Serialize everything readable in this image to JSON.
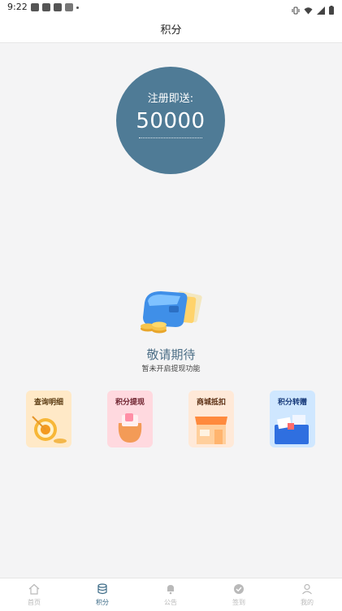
{
  "status": {
    "time": "9:22"
  },
  "header": {
    "title": "积分"
  },
  "points": {
    "label": "注册即送:",
    "value": "50000"
  },
  "coming_soon": {
    "title": "敬请期待",
    "subtitle": "暂未开启提现功能"
  },
  "cards": [
    {
      "label": "查询明细",
      "color": "#ffe9c7"
    },
    {
      "label": "积分提现",
      "color": "#ffd9df"
    },
    {
      "label": "商城抵扣",
      "color": "#ffe9d8"
    },
    {
      "label": "积分转赠",
      "color": "#cfe7ff"
    }
  ],
  "nav": [
    {
      "label": "首页",
      "icon": "home-icon"
    },
    {
      "label": "积分",
      "icon": "database-icon",
      "active": true
    },
    {
      "label": "公告",
      "icon": "bell-icon"
    },
    {
      "label": "签到",
      "icon": "check-circle-icon"
    },
    {
      "label": "我的",
      "icon": "user-icon"
    }
  ],
  "colors": {
    "accent": "#4f7b96",
    "nav_active": "#3b6a86",
    "nav_inactive": "#b9b9b9"
  }
}
